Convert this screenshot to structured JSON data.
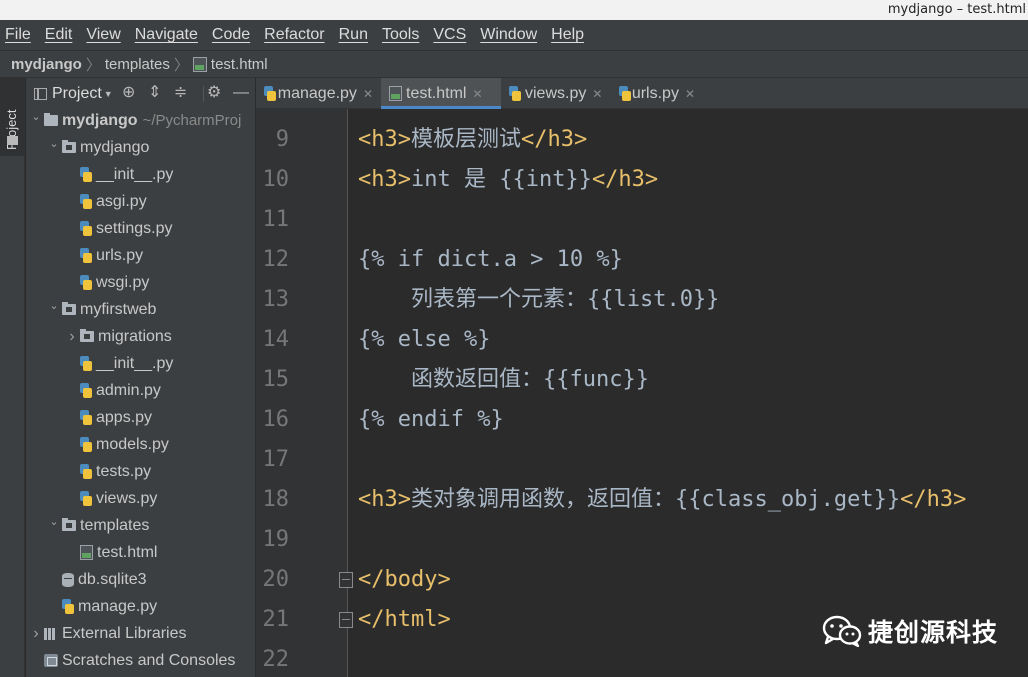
{
  "window": {
    "title": "mydjango – test.html"
  },
  "menu": [
    "File",
    "Edit",
    "View",
    "Navigate",
    "Code",
    "Refactor",
    "Run",
    "Tools",
    "VCS",
    "Window",
    "Help"
  ],
  "breadcrumb": {
    "root": "mydjango",
    "folder": "templates",
    "file": "test.html"
  },
  "stripe": {
    "project_label": "Project"
  },
  "project_panel": {
    "title": "Project",
    "tree": [
      {
        "label": "mydjango",
        "hint": "~/PycharmProj",
        "type": "folder",
        "depth": 0,
        "expanded": true,
        "bold": true
      },
      {
        "label": "mydjango",
        "type": "folder",
        "depth": 1,
        "expanded": true
      },
      {
        "label": "__init__.py",
        "type": "py",
        "depth": 2
      },
      {
        "label": "asgi.py",
        "type": "py",
        "depth": 2
      },
      {
        "label": "settings.py",
        "type": "py",
        "depth": 2
      },
      {
        "label": "urls.py",
        "type": "py",
        "depth": 2
      },
      {
        "label": "wsgi.py",
        "type": "py",
        "depth": 2
      },
      {
        "label": "myfirstweb",
        "type": "folder",
        "depth": 1,
        "expanded": true
      },
      {
        "label": "migrations",
        "type": "folder",
        "depth": 2,
        "expanded": false
      },
      {
        "label": "__init__.py",
        "type": "py",
        "depth": 2
      },
      {
        "label": "admin.py",
        "type": "py",
        "depth": 2
      },
      {
        "label": "apps.py",
        "type": "py",
        "depth": 2
      },
      {
        "label": "models.py",
        "type": "py",
        "depth": 2
      },
      {
        "label": "tests.py",
        "type": "py",
        "depth": 2
      },
      {
        "label": "views.py",
        "type": "py",
        "depth": 2
      },
      {
        "label": "templates",
        "type": "folder",
        "depth": 1,
        "expanded": true
      },
      {
        "label": "test.html",
        "type": "html",
        "depth": 2
      },
      {
        "label": "db.sqlite3",
        "type": "db",
        "depth": 1
      },
      {
        "label": "manage.py",
        "type": "py",
        "depth": 1
      },
      {
        "label": "External Libraries",
        "type": "lib",
        "depth": 0,
        "expanded": false
      },
      {
        "label": "Scratches and Consoles",
        "type": "scratch",
        "depth": 0
      }
    ]
  },
  "tabs": [
    {
      "label": "manage.py",
      "type": "py",
      "active": false
    },
    {
      "label": "test.html",
      "type": "html",
      "active": true
    },
    {
      "label": "views.py",
      "type": "py",
      "active": false
    },
    {
      "label": "urls.py",
      "type": "py",
      "active": false
    }
  ],
  "editor": {
    "lines": [
      {
        "no": "9",
        "tokens": [
          {
            "t": "tag",
            "v": "<h3>"
          },
          {
            "t": "tpl",
            "v": "模板层测试"
          },
          {
            "t": "tag",
            "v": "</h3>"
          }
        ]
      },
      {
        "no": "10",
        "tokens": [
          {
            "t": "tag",
            "v": "<h3>"
          },
          {
            "t": "tpl",
            "v": "int 是 {{int}}"
          },
          {
            "t": "tag",
            "v": "</h3>"
          }
        ]
      },
      {
        "no": "11",
        "tokens": []
      },
      {
        "no": "12",
        "tokens": [
          {
            "t": "tpl",
            "v": "{% if dict.a > 10 %}"
          }
        ]
      },
      {
        "no": "13",
        "tokens": [
          {
            "t": "tpl",
            "v": "    列表第一个元素：{{list.0}}"
          }
        ]
      },
      {
        "no": "14",
        "tokens": [
          {
            "t": "tpl",
            "v": "{% else %}"
          }
        ]
      },
      {
        "no": "15",
        "tokens": [
          {
            "t": "tpl",
            "v": "    函数返回值：{{func}}"
          }
        ]
      },
      {
        "no": "16",
        "tokens": [
          {
            "t": "tpl",
            "v": "{% endif %}"
          }
        ]
      },
      {
        "no": "17",
        "tokens": []
      },
      {
        "no": "18",
        "tokens": [
          {
            "t": "tag",
            "v": "<h3>"
          },
          {
            "t": "tpl",
            "v": "类对象调用函数，返回值：{{class_obj.get}}"
          },
          {
            "t": "tag",
            "v": "</h3>"
          }
        ]
      },
      {
        "no": "19",
        "tokens": []
      },
      {
        "no": "20",
        "fold": true,
        "tokens": [
          {
            "t": "tag",
            "v": "</body>"
          }
        ]
      },
      {
        "no": "21",
        "fold": true,
        "tokens": [
          {
            "t": "tag",
            "v": "</html>"
          }
        ]
      },
      {
        "no": "22",
        "tokens": []
      }
    ]
  },
  "watermark": {
    "text": "捷创源科技"
  },
  "colors": {
    "tag": "#e8bf6a",
    "text": "#a9b7c6",
    "accent": "#4a88c7"
  }
}
